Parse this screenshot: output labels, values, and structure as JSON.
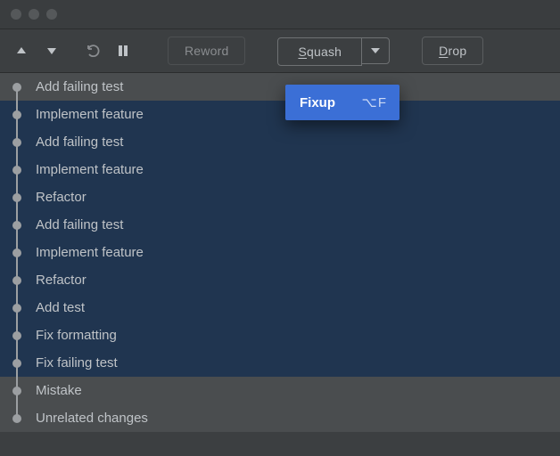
{
  "toolbar": {
    "reword_label": "Reword",
    "squash_mnemonic": "S",
    "squash_rest": "quash",
    "drop_mnemonic": "D",
    "drop_rest": "rop"
  },
  "dropdown": {
    "fixup_label": "Fixup",
    "fixup_shortcut": "⌥F"
  },
  "commits": [
    {
      "message": "Add failing test",
      "selected": false
    },
    {
      "message": "Implement feature",
      "selected": true
    },
    {
      "message": "Add failing test",
      "selected": true
    },
    {
      "message": "Implement feature",
      "selected": true
    },
    {
      "message": "Refactor",
      "selected": true
    },
    {
      "message": "Add failing test",
      "selected": true
    },
    {
      "message": "Implement feature",
      "selected": true
    },
    {
      "message": "Refactor",
      "selected": true
    },
    {
      "message": "Add test",
      "selected": true
    },
    {
      "message": "Fix formatting",
      "selected": true
    },
    {
      "message": "Fix failing test",
      "selected": true
    },
    {
      "message": "Mistake",
      "selected": false
    },
    {
      "message": "Unrelated changes",
      "selected": false
    }
  ]
}
